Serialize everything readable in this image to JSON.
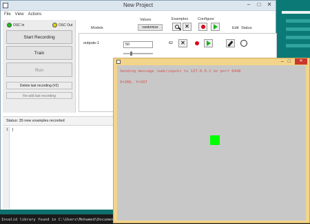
{
  "window": {
    "title": "New Project"
  },
  "menu": {
    "items": [
      "File",
      "View",
      "Actions"
    ]
  },
  "osc": {
    "in_label": "OSC In",
    "out_label": "OSC Out",
    "in_color": "#13c313",
    "out_color": "#e6d000"
  },
  "left_panel": {
    "start_recording": "Start Recording",
    "train": "Train",
    "run": "Run",
    "delete_last": "Delete last recording (#2)",
    "readd_last": "Re-add last recording"
  },
  "status": {
    "text": "Status:  35 new examples recorded"
  },
  "model_area": {
    "models_header": "Models",
    "values_header": "Values",
    "randomize_label": "randomize",
    "examples_header": "Examples",
    "configure_header": "Configure",
    "edit_header": "Edit",
    "status_header": "Status",
    "output_name": "outputs-1",
    "output_value": "50",
    "example_count": "62"
  },
  "editor": {
    "line_number": "1",
    "content": "]"
  },
  "console": {
    "text": "Invalid library found in C:\\Users\\Mohamed\\Documents"
  },
  "sketch": {
    "message_line": "Sending message /wek/inputs to 127.0.0.1 on port 6448",
    "coords_line": "X=286, Y=207",
    "square_color": "#00ff00"
  },
  "icons": {
    "osc_in": "status-dot-icon",
    "examples_search": "magnifier-icon",
    "examples_delete": "x-icon",
    "record": "record-icon",
    "play": "play-icon",
    "edit": "pencil-icon",
    "status": "circle-icon"
  }
}
